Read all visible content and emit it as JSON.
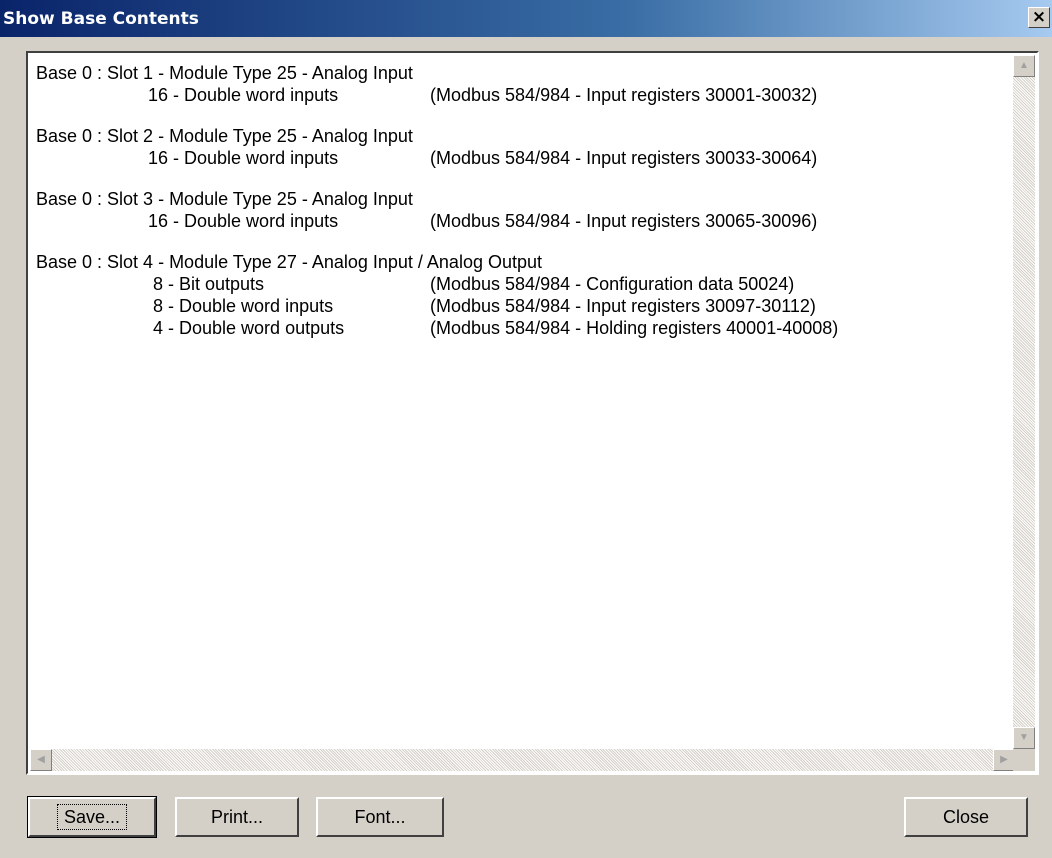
{
  "window": {
    "title": "Show Base Contents",
    "close_glyph": "×"
  },
  "textview": {
    "blocks": [
      {
        "header": "Base 0 : Slot 1 - Module Type 25 - Analog Input",
        "lines": [
          {
            "label": "16 - Double word inputs",
            "desc": "(Modbus 584/984 - Input registers 30001-30032)"
          }
        ]
      },
      {
        "header": "Base 0 : Slot 2 - Module Type 25 - Analog Input",
        "lines": [
          {
            "label": "16 - Double word inputs",
            "desc": "(Modbus 584/984 - Input registers 30033-30064)"
          }
        ]
      },
      {
        "header": "Base 0 : Slot 3 - Module Type 25 - Analog Input",
        "lines": [
          {
            "label": "16 - Double word inputs",
            "desc": "(Modbus 584/984 - Input registers 30065-30096)"
          }
        ]
      },
      {
        "header": "Base 0 : Slot 4 - Module Type 27 - Analog Input / Analog Output",
        "lines": [
          {
            "label": " 8 - Bit outputs",
            "desc": "(Modbus 584/984 - Configuration data 50024)"
          },
          {
            "label": " 8 - Double word inputs",
            "desc": "(Modbus 584/984 - Input registers 30097-30112)"
          },
          {
            "label": " 4 - Double word outputs",
            "desc": "(Modbus 584/984 - Holding registers 40001-40008)"
          }
        ]
      }
    ],
    "scroll_arrows": {
      "up": "▲",
      "down": "▼",
      "left": "◀",
      "right": "▶"
    }
  },
  "buttons": {
    "save": "Save...",
    "print": "Print...",
    "font": "Font...",
    "close": "Close"
  }
}
